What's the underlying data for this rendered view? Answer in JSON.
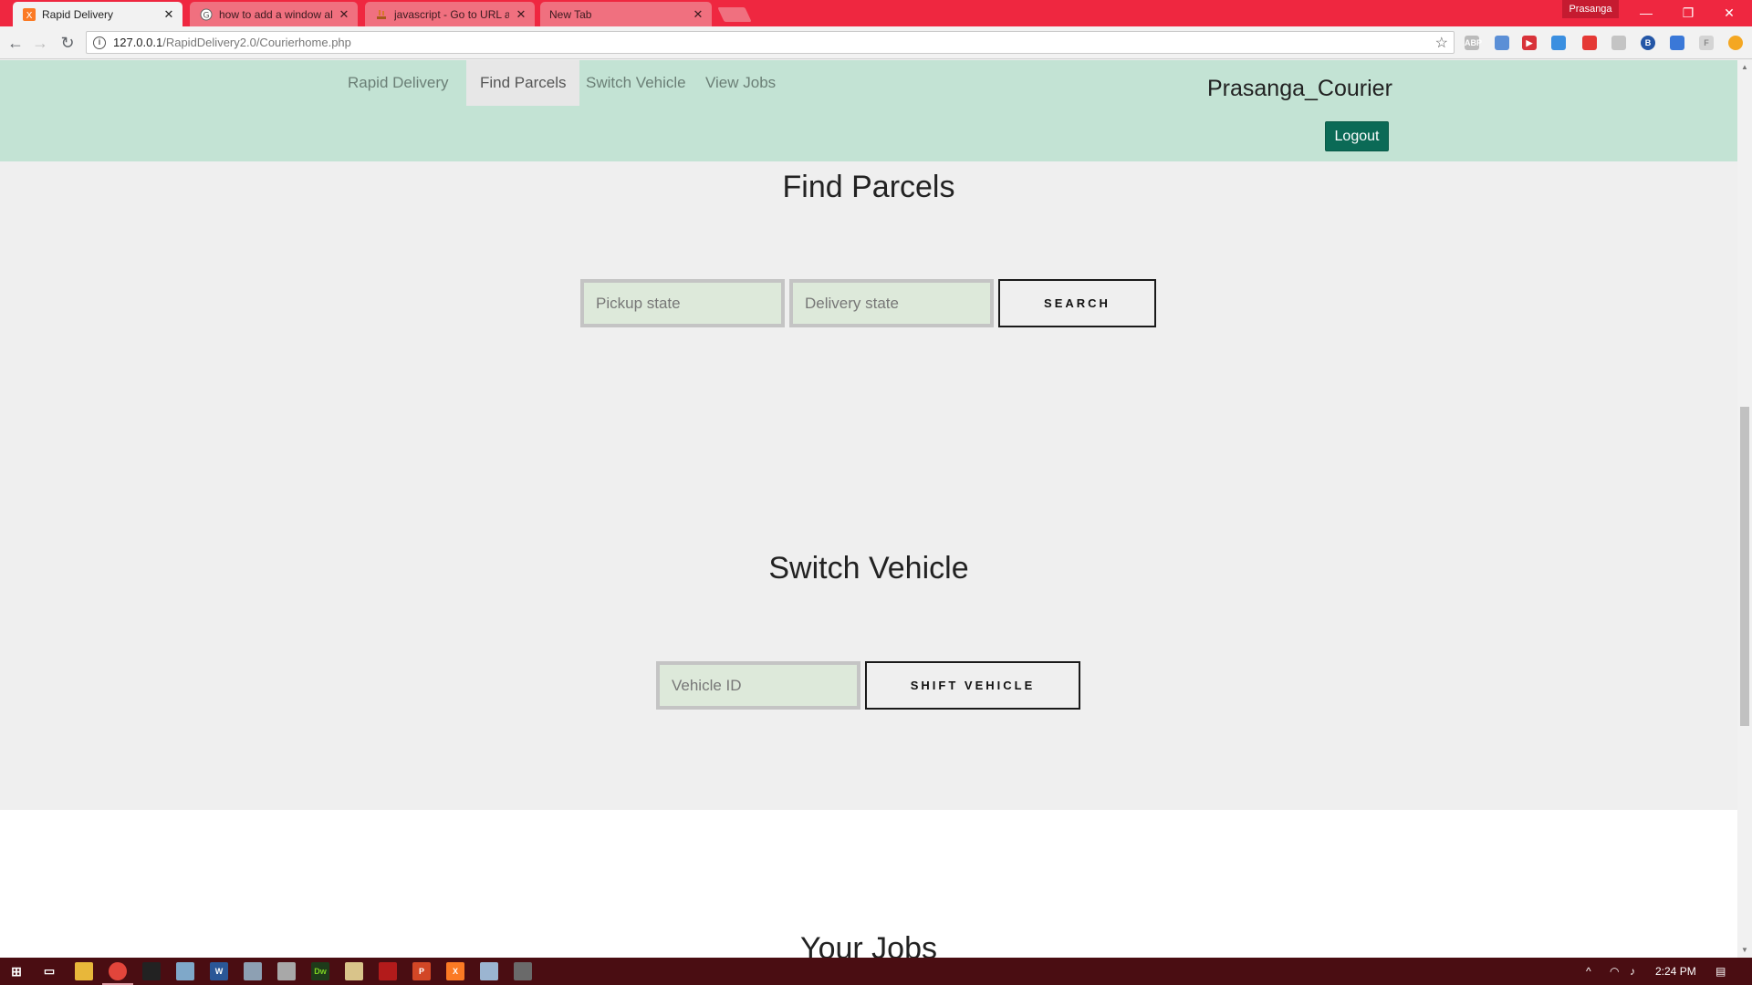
{
  "browser": {
    "tabs": [
      {
        "title": "Rapid Delivery",
        "favicon": "xampp-icon",
        "active": true
      },
      {
        "title": "how to add a window ale",
        "favicon": "google-icon",
        "active": false
      },
      {
        "title": "javascript - Go to URL af",
        "favicon": "stackoverflow-icon",
        "active": false
      },
      {
        "title": "New Tab",
        "favicon": "",
        "active": false
      }
    ],
    "profile_name": "Prasanga",
    "url_host": "127.0.0.1",
    "url_path": "/RapidDelivery2.0/Courierhome.php"
  },
  "navbar": {
    "brand": "Rapid Delivery",
    "links": [
      "Find Parcels",
      "Switch Vehicle",
      "View Jobs"
    ],
    "active_link": "Find Parcels",
    "username": "Prasanga_Courier",
    "logout_label": "Logout"
  },
  "find_parcels": {
    "title": "Find Parcels",
    "pickup_placeholder": "Pickup state",
    "delivery_placeholder": "Delivery state",
    "search_label": "SEARCH"
  },
  "switch_vehicle": {
    "title": "Switch Vehicle",
    "vehicle_placeholder": "Vehicle ID",
    "shift_label": "SHIFT VEHICLE"
  },
  "jobs": {
    "title": "Your Jobs"
  },
  "taskbar": {
    "time": "2:24 PM"
  },
  "colors": {
    "titlebar": "#ef2740",
    "navbar_bg": "#c3e3d4",
    "logout_bg": "#0b6a56",
    "input_bg": "#dde9da",
    "taskbar": "#4a0d12"
  }
}
